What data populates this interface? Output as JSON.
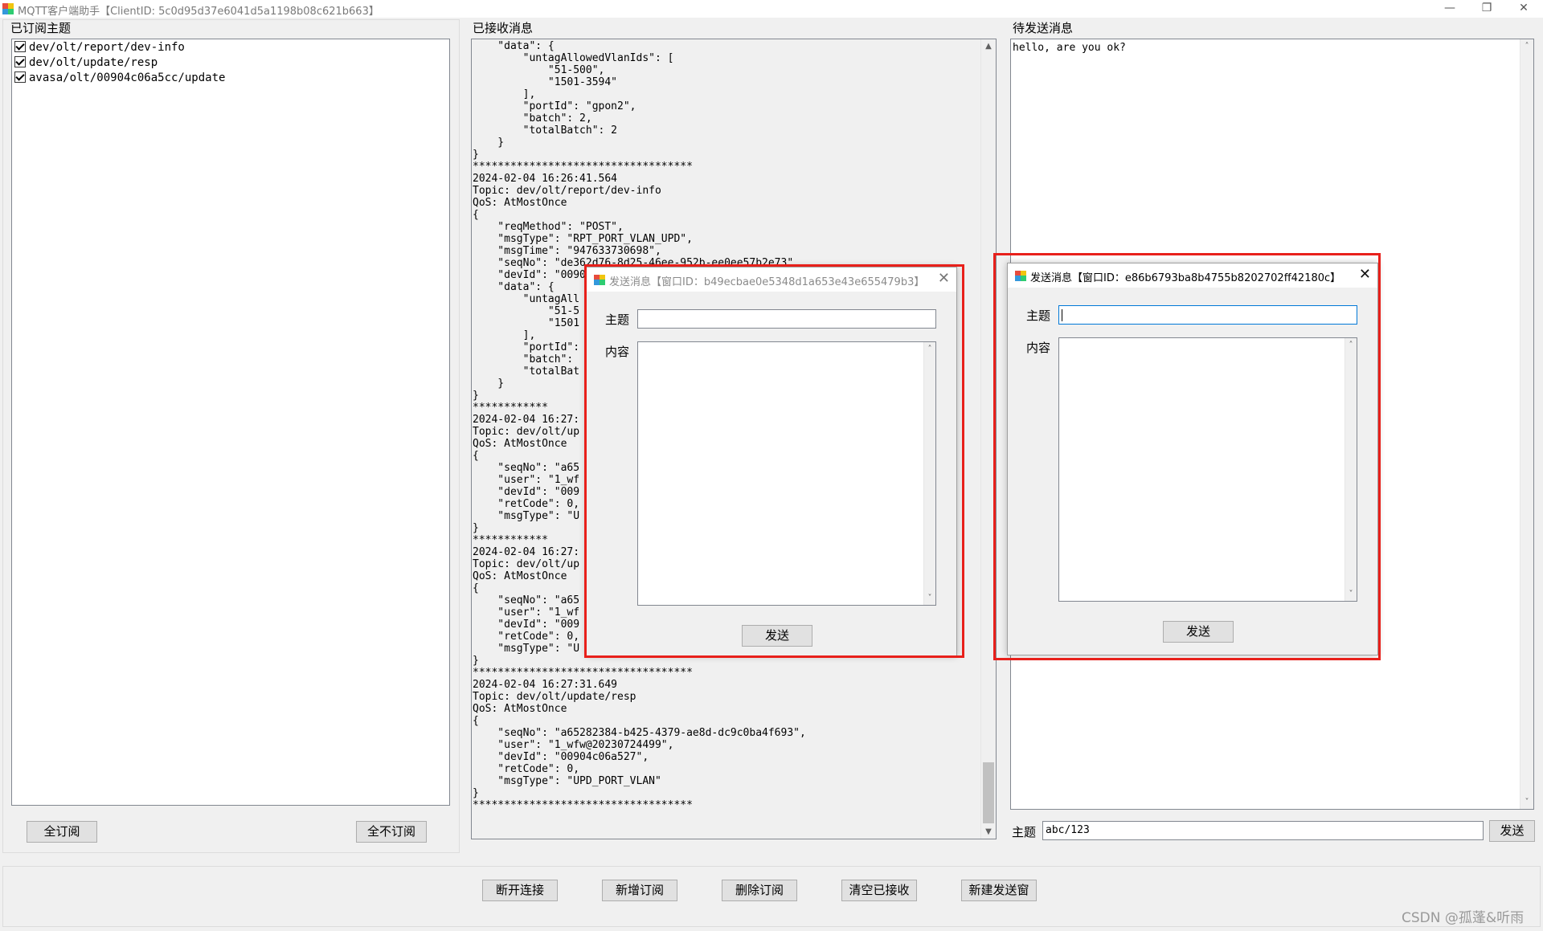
{
  "window": {
    "title": "MQTT客户端助手【ClientID: 5c0d95d37e6041d5a1198b08c621b663】",
    "minimize": "—",
    "restore": "❐",
    "close": "✕"
  },
  "left": {
    "header": "已订阅主题",
    "topics": [
      "dev/olt/report/dev-info",
      "dev/olt/update/resp",
      "avasa/olt/00904c06a5cc/update"
    ],
    "subscribe_all": "全订阅",
    "unsubscribe_all": "全不订阅"
  },
  "middle": {
    "header": "已接收消息",
    "text": "    \"data\": {\n        \"untagAllowedVlanIds\": [\n            \"51-500\",\n            \"1501-3594\"\n        ],\n        \"portId\": \"gpon2\",\n        \"batch\": 2,\n        \"totalBatch\": 2\n    }\n}\n***********************************\n2024-02-04 16:26:41.564\nTopic: dev/olt/report/dev-info\nQoS: AtMostOnce\n{\n    \"reqMethod\": \"POST\",\n    \"msgType\": \"RPT_PORT_VLAN_UPD\",\n    \"msgTime\": \"947633730698\",\n    \"seqNo\": \"de362d76-8d25-46ee-952b-ee0ee57b2e73\",\n    \"devId\": \"0090\n    \"data\": {\n        \"untagAll\n            \"51-5\n            \"1501\n        ],\n        \"portId\":\n        \"batch\":\n        \"totalBat\n    }\n}\n************\n2024-02-04 16:27:\nTopic: dev/olt/up\nQoS: AtMostOnce\n{\n    \"seqNo\": \"a65\n    \"user\": \"1_wf\n    \"devId\": \"009\n    \"retCode\": 0,\n    \"msgType\": \"U\n}\n************\n2024-02-04 16:27:\nTopic: dev/olt/up\nQoS: AtMostOnce\n{\n    \"seqNo\": \"a65\n    \"user\": \"1_wf\n    \"devId\": \"009\n    \"retCode\": 0,\n    \"msgType\": \"U\n}\n***********************************\n2024-02-04 16:27:31.649\nTopic: dev/olt/update/resp\nQoS: AtMostOnce\n{\n    \"seqNo\": \"a65282384-b425-4379-ae8d-dc9c0ba4f693\",\n    \"user\": \"1_wfw@20230724499\",\n    \"devId\": \"00904c06a527\",\n    \"retCode\": 0,\n    \"msgType\": \"UPD_PORT_VLAN\"\n}\n***********************************"
  },
  "right": {
    "header": "待发送消息",
    "message_text": "hello, are you ok?",
    "topic_label": "主题",
    "topic_value": "abc/123",
    "send_label": "发送"
  },
  "bottom": {
    "disconnect": "断开连接",
    "add_subscription": "新增订阅",
    "delete_subscription": "删除订阅",
    "clear_received": "清空已接收",
    "new_send_window": "新建发送窗"
  },
  "dialog1": {
    "title": "发送消息【窗口ID：b49ecbae0e5348d1a653e43e655479b3】",
    "topic_label": "主题",
    "content_label": "内容",
    "send_label": "发送",
    "close": "✕"
  },
  "dialog2": {
    "title": "发送消息【窗口ID：e86b6793ba8b4755b8202702ff42180c】",
    "topic_label": "主题",
    "content_label": "内容",
    "send_label": "发送",
    "close": "✕"
  },
  "watermark": "CSDN @孤蓬&听雨",
  "colors": {
    "highlight_frame": "#e8201b",
    "focus_border": "#0078d7"
  }
}
